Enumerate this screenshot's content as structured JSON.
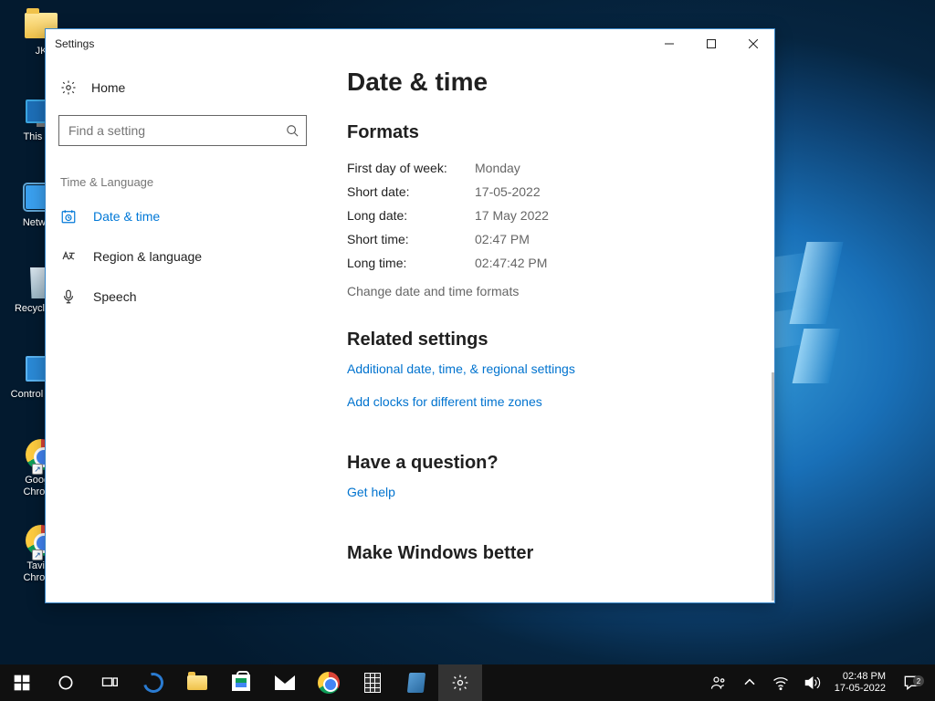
{
  "desktop_icons": [
    {
      "label": "JK"
    },
    {
      "label": "This PC"
    },
    {
      "label": "Network"
    },
    {
      "label": "Recycle Bin"
    },
    {
      "label": "Control Panel"
    },
    {
      "label": "Google Chrome"
    },
    {
      "label": "Taviya Chrome"
    }
  ],
  "window": {
    "title": "Settings",
    "home": "Home",
    "search_placeholder": "Find a setting",
    "category": "Time & Language",
    "nav": {
      "date_time": "Date & time",
      "region": "Region & language",
      "speech": "Speech"
    }
  },
  "main": {
    "title": "Date & time",
    "formats_heading": "Formats",
    "formats": [
      {
        "k": "First day of week:",
        "v": "Monday"
      },
      {
        "k": "Short date:",
        "v": "17-05-2022"
      },
      {
        "k": "Long date:",
        "v": "17 May 2022"
      },
      {
        "k": "Short time:",
        "v": "02:47 PM"
      },
      {
        "k": "Long time:",
        "v": "02:47:42 PM"
      }
    ],
    "change_formats": "Change date and time formats",
    "related_heading": "Related settings",
    "link_additional": "Additional date, time, & regional settings",
    "link_clocks": "Add clocks for different time zones",
    "question_heading": "Have a question?",
    "get_help": "Get help",
    "feedback_heading": "Make Windows better"
  },
  "taskbar": {
    "time": "02:48 PM",
    "date": "17-05-2022",
    "notif_count": "2"
  }
}
